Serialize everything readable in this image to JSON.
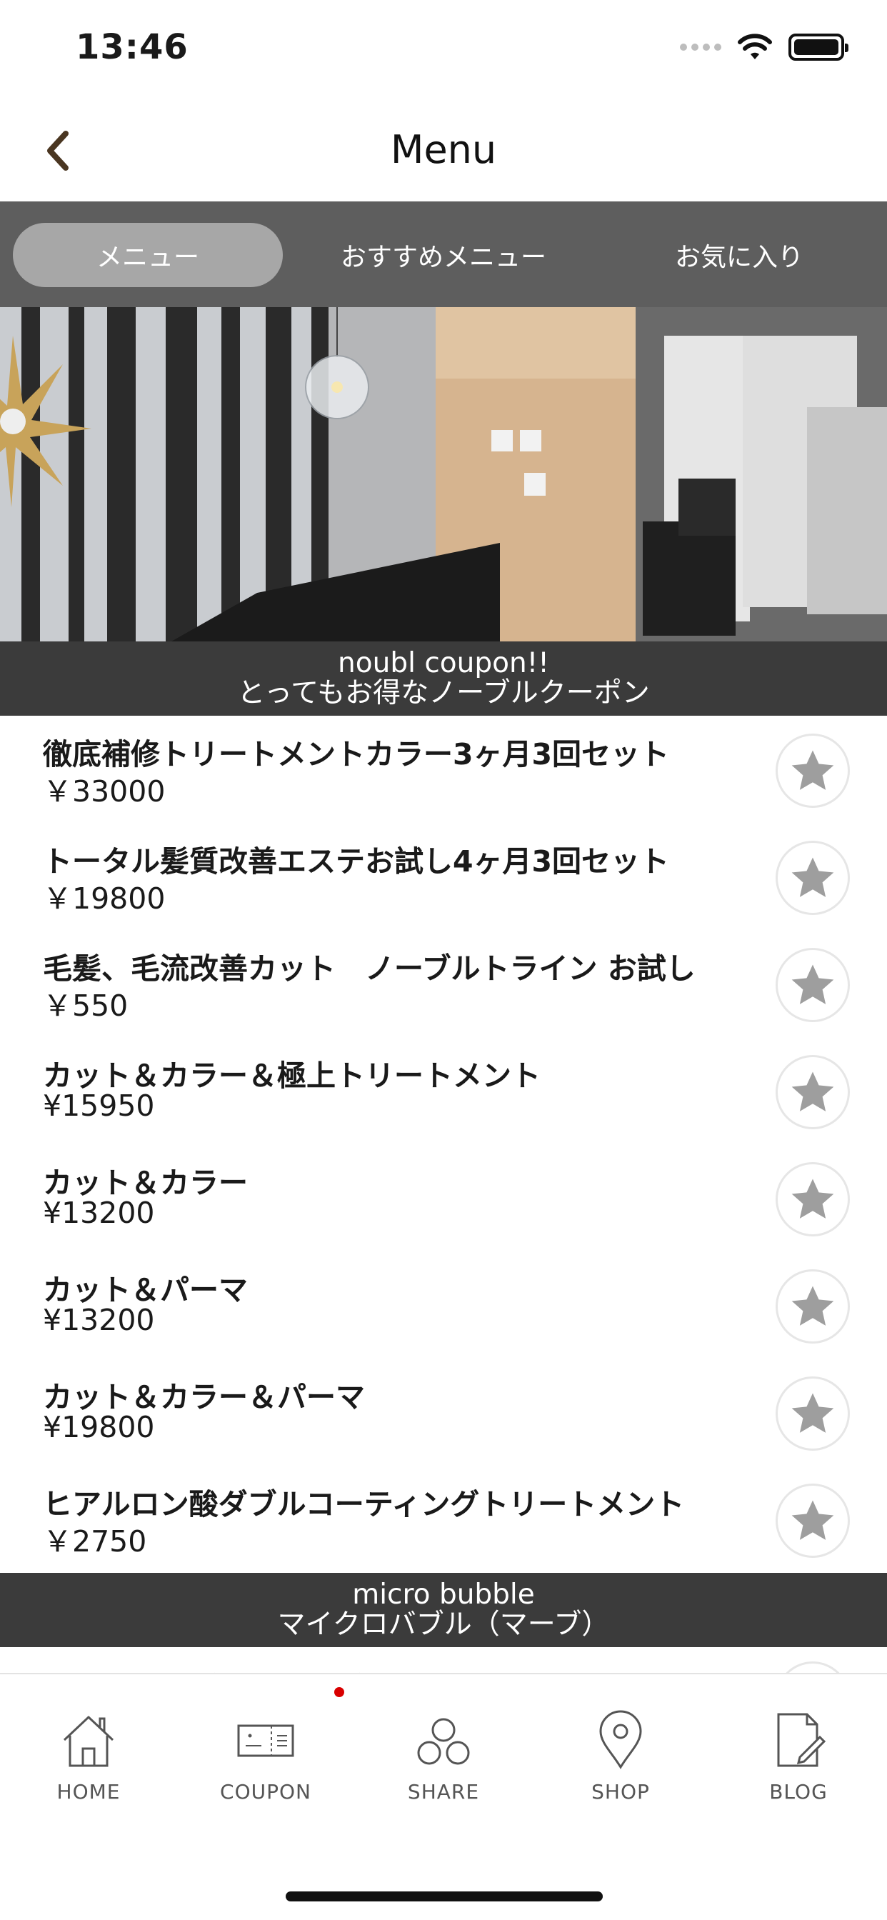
{
  "status_bar": {
    "time": "13:46"
  },
  "nav": {
    "title": "Menu"
  },
  "tabs": [
    {
      "label": "メニュー",
      "active": true
    },
    {
      "label": "おすすめメニュー",
      "active": false
    },
    {
      "label": "お気に入り",
      "active": false
    }
  ],
  "sections": [
    {
      "title": "noubl coupon!!",
      "subtitle": "とってもお得なノーブルクーポン",
      "items": [
        {
          "title": "徹底補修トリートメントカラー3ヶ月3回セット",
          "price": "￥33000"
        },
        {
          "title": "トータル髪質改善エステお試し4ヶ月3回セット",
          "price": "￥19800"
        },
        {
          "title": "毛髪、毛流改善カット　ノーブルトライン お試し",
          "price": "￥550"
        },
        {
          "title": "カット＆カラー＆極上トリートメント",
          "price": "¥15950"
        },
        {
          "title": "カット＆カラー",
          "price": "¥13200"
        },
        {
          "title": "カット＆パーマ",
          "price": "¥13200"
        },
        {
          "title": "カット＆カラー＆パーマ",
          "price": "¥19800"
        },
        {
          "title": "ヒアルロン酸ダブルコーティングトリートメント",
          "price": "￥2750"
        }
      ]
    },
    {
      "title": "micro bubble",
      "subtitle": "マイクロバブル（マーブ）",
      "items": [
        {
          "title": "マイクロバブル（マーブ）",
          "price": ""
        }
      ]
    }
  ],
  "bottom_nav": [
    {
      "label": "HOME",
      "icon": "home-icon"
    },
    {
      "label": "COUPON",
      "icon": "coupon-icon"
    },
    {
      "label": "SHARE",
      "icon": "share-icon"
    },
    {
      "label": "SHOP",
      "icon": "map-pin-icon"
    },
    {
      "label": "BLOG",
      "icon": "blog-icon"
    }
  ],
  "colors": {
    "tab_bar_bg": "#5e5e5e",
    "tab_active_bg": "#a7a7a7",
    "section_header_bg": "#3b3b3b",
    "star": "#9e9e9e",
    "notification_dot": "#d90000",
    "back_arrow": "#4a3621"
  }
}
